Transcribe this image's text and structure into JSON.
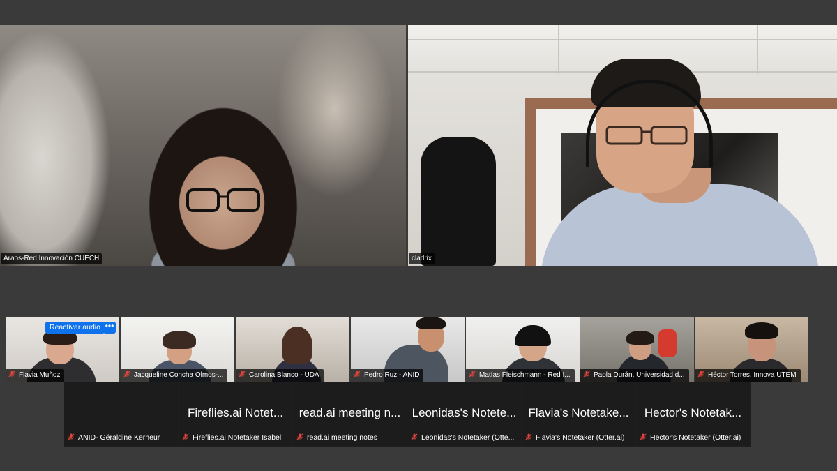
{
  "speakers": [
    {
      "name": "Araos-Red Innovación CUECH",
      "active": true
    },
    {
      "name": "cladrix",
      "active": false
    }
  ],
  "gallery": [
    {
      "name": "Flavia Muñoz",
      "muted": true
    },
    {
      "name": "Jacqueline Concha Olmos-...",
      "muted": true
    },
    {
      "name": "Carolina Blanco - UDA",
      "muted": true
    },
    {
      "name": "Pedro Ruz - ANID",
      "muted": true
    },
    {
      "name": "Matías Fleischmann - Red I...",
      "muted": true
    },
    {
      "name": "Paola Durán, Universidad d...",
      "muted": true
    },
    {
      "name": "Héctor Torres. Innova UTEM",
      "muted": true
    }
  ],
  "hover_controls": {
    "reactivate_audio_label": "Reactivar audio",
    "more_label": "•••"
  },
  "no_video": [
    {
      "title": "",
      "name": "ANID- Géraldine Kerneur"
    },
    {
      "title": "Fireflies.ai Notet...",
      "name": "Fireflies.ai Notetaker Isabel"
    },
    {
      "title": "read.ai meeting n...",
      "name": "read.ai meeting notes"
    },
    {
      "title": "Leonidas's Notete...",
      "name": "Leonidas's Notetaker (Otte..."
    },
    {
      "title": "Flavia's Notetake...",
      "name": "Flavia's Notetaker (Otter.ai)"
    },
    {
      "title": "Hector's Notetak...",
      "name": "Hector's Notetaker (Otter.ai)"
    }
  ],
  "colors": {
    "background": "#3a3a3a",
    "active_speaker_border": "#3ec45a",
    "muted_icon": "#e0433c",
    "button_blue": "#0e72ed"
  }
}
